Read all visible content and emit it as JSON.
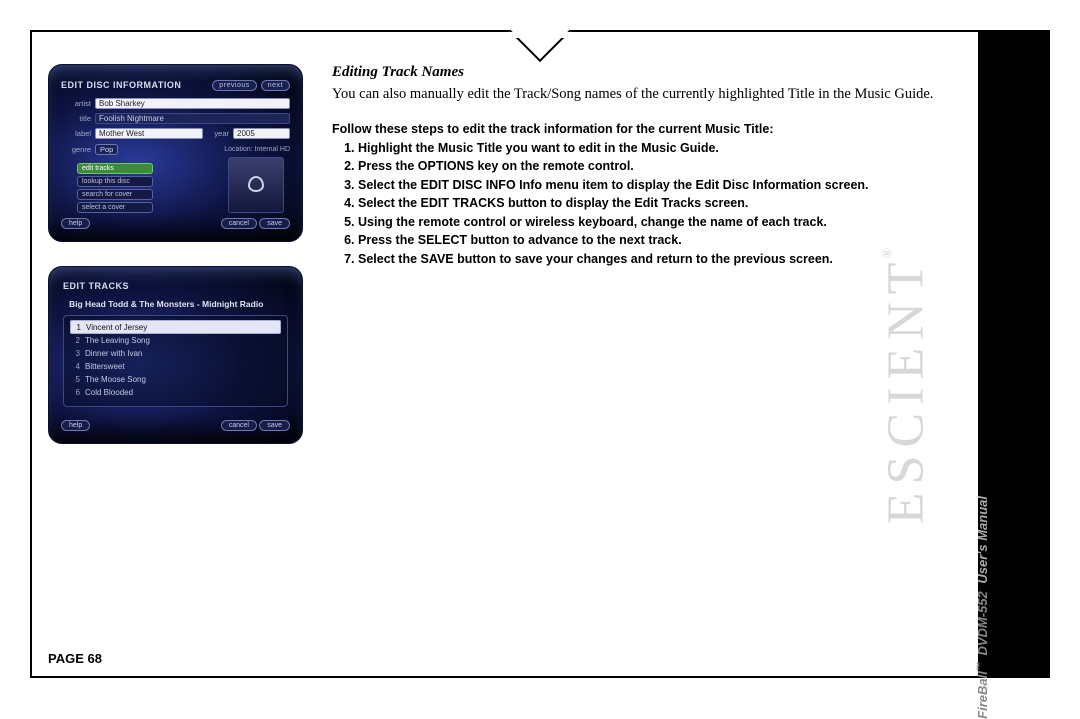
{
  "page": {
    "heading": "Editing Track Names",
    "intro": "You can also manually edit the Track/Song names of the currently highlighted Title in the Music Guide.",
    "steps_intro": "Follow these steps to edit the track information for the current Music Title:",
    "steps": [
      "Highlight the Music Title you want to edit in the Music Guide.",
      "Press the OPTIONS key on the remote control.",
      "Select the EDIT DISC INFO Info menu item to display the Edit Disc Information screen.",
      "Select the EDIT TRACKS button to display the Edit Tracks screen.",
      "Using the remote control or wireless keyboard, change the name of each track.",
      "Press the SELECT button to advance to the next track.",
      "Select the SAVE button to save your changes and return to the previous screen."
    ],
    "footer": "PAGE 68"
  },
  "sidebar": {
    "brand": "ESCIENT",
    "reg": "®",
    "product": "FireBall",
    "tm": "™",
    "model": "DVDM-552",
    "manual": "User's Manual"
  },
  "shot1": {
    "title": "EDIT DISC INFORMATION",
    "prev_btn": "previous",
    "next_btn": "next",
    "labels": {
      "artist": "artist",
      "title": "title",
      "label": "label",
      "year": "year",
      "genre": "genre"
    },
    "artist_value": "Bob Sharkey",
    "title_value": "Foolish Nightmare",
    "label_value": "Mother West",
    "year_value": "2005",
    "genre_value": "Pop",
    "location_label": "Location: Internal HD",
    "options": [
      {
        "label": "edit tracks",
        "hl": true
      },
      {
        "label": "lookup this disc",
        "hl": false
      },
      {
        "label": "search for cover",
        "hl": false
      },
      {
        "label": "select a cover",
        "hl": false
      }
    ],
    "help_btn": "help",
    "cancel_btn": "cancel",
    "save_btn": "save"
  },
  "shot2": {
    "title": "EDIT TRACKS",
    "header_text": "Big Head Todd & The Monsters - Midnight Radio",
    "tracks": [
      {
        "n": "1",
        "name": "Vincent of Jersey",
        "hl": true
      },
      {
        "n": "2",
        "name": "The Leaving Song",
        "hl": false
      },
      {
        "n": "3",
        "name": "Dinner with Ivan",
        "hl": false
      },
      {
        "n": "4",
        "name": "Bittersweet",
        "hl": false
      },
      {
        "n": "5",
        "name": "The Moose Song",
        "hl": false
      },
      {
        "n": "6",
        "name": "Cold Blooded",
        "hl": false
      }
    ],
    "help_btn": "help",
    "cancel_btn": "cancel",
    "save_btn": "save"
  }
}
